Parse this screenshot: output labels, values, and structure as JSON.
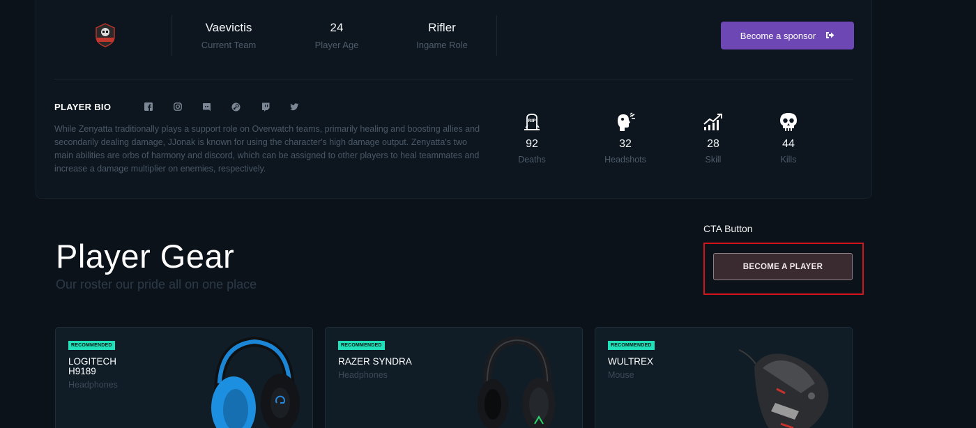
{
  "profile": {
    "stats": [
      {
        "value": "Vaevictis",
        "label": "Current Team"
      },
      {
        "value": "24",
        "label": "Player Age"
      },
      {
        "value": "Rifler",
        "label": "Ingame Role"
      }
    ],
    "sponsor_label": "Become a sponsor"
  },
  "bio": {
    "title": "PLAYER BIO",
    "socials": [
      "facebook-icon",
      "instagram-icon",
      "discord-icon",
      "steam-icon",
      "twitch-icon",
      "twitter-icon"
    ],
    "text": "While Zenyatta traditionally plays a support role on Overwatch teams, primarily healing and boosting allies and secondarily dealing damage, JJonak is known for using the character's high damage output. Zenyatta's two main abilities are orbs of harmony and discord, which can be assigned to other players to heal teammates and increase a damage multiplier on enemies, respectively."
  },
  "kill_stats": [
    {
      "icon": "rip-icon",
      "value": "92",
      "label": "Deaths"
    },
    {
      "icon": "headshot-icon",
      "value": "32",
      "label": "Headshots"
    },
    {
      "icon": "skill-chart-icon",
      "value": "28",
      "label": "Skill"
    },
    {
      "icon": "skull-icon",
      "value": "44",
      "label": "Kills"
    }
  ],
  "gear": {
    "title": "Player Gear",
    "subtitle": "Our roster our pride all on one place",
    "cta_label": "CTA Button",
    "cta_button": "BECOME A PLAYER",
    "products": [
      {
        "badge": "RECOMMENDED",
        "name": "LOGITECH H9189",
        "category": "Headphones"
      },
      {
        "badge": "RECOMMENDED",
        "name": "RAZER SYNDRA",
        "category": "Headphones"
      },
      {
        "badge": "RECOMMENDED",
        "name": "WULTREX",
        "category": "Mouse"
      }
    ]
  },
  "colors": {
    "accent": "#6d48b4",
    "badge": "#1fe0b9",
    "highlight": "#d4141c"
  }
}
